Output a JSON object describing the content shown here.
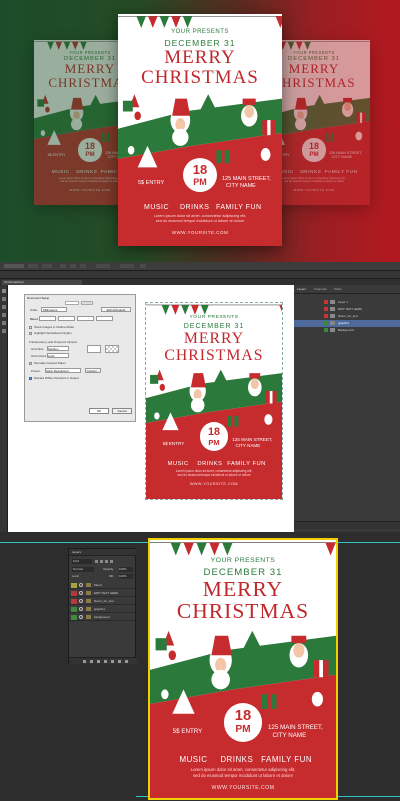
{
  "flyer": {
    "presents": "YOUR PRESENTS",
    "date": "DECEMBER 31",
    "title_line1": "MERRY",
    "title_line2": "CHRISTMAS",
    "price_number": "18",
    "price_unit": "PM",
    "entry": "5$ ENTRY",
    "address_line1": "125 MAIN STREET,",
    "address_line2": "CITY NAME",
    "features": [
      "MUSIC",
      "DRINKS",
      "FAMILY FUN"
    ],
    "lorem_line1": "Lorem ipsum dolor sit amet, consectetur adipiscing elit,",
    "lorem_line2": "sed do eiusmod tempor incididunt ut labore et dolore",
    "website": "WWW.YOURSITE.COM"
  },
  "photoshop": {
    "tab_label": "ChristmasFlyer",
    "dialog": {
      "title": "Document Setup",
      "tabs": [
        "General",
        "Bleed",
        "Size"
      ],
      "units_label": "Units:",
      "units_value": "Millimeters",
      "edit_artboards_button": "Edit Artboards",
      "bleed_label": "Bleed:",
      "bleed_fields": [
        "Top",
        "Bottom",
        "Left",
        "Right"
      ],
      "bleed_values": [
        "0.3 mm",
        "0.3 mm",
        "0.3 mm",
        "0.3 mm"
      ],
      "checkboxes": [
        "Show Images in Outline Mode",
        "Highlight Substituted Glyphs"
      ],
      "transparency_label": "Transparency and Overprint Options",
      "grid_size_label": "Grid Size:",
      "grid_size_value": "Medium",
      "grid_colors_label": "Grid Colors:",
      "grid_colors_value": "Light",
      "sim_paper": "Simulate Colored Paper",
      "preset_label": "Preset:",
      "preset_value": "[High Resolution]",
      "custom_button": "Custom...",
      "discard_white": "Discard White Overprint in Output",
      "ok_button": "OK",
      "cancel_button": "Cancel"
    },
    "panel_tabs": [
      "Layers",
      "Channels",
      "Paths"
    ],
    "layers_right": [
      "Layer 1",
      "EDIT TEXT HERE",
      "flower_for_text",
      "graphics",
      "Background"
    ]
  },
  "layers_panel": {
    "title": "Layers",
    "kind_label": "Kind",
    "blend_mode": "Normal",
    "opacity_label": "Opacity:",
    "opacity_value": "100%",
    "lock_label": "Lock:",
    "fill_label": "Fill:",
    "fill_value": "100%",
    "layers": [
      "Mood",
      "EDIT TEXT HERE",
      "flower_for_text",
      "graphics",
      "background"
    ],
    "layer_colors": [
      "#a8a23a",
      "#b23a3a",
      "#b23a3a",
      "#3f8a3f",
      "#3f8a3f"
    ]
  },
  "colors": {
    "red": "#c62b2e",
    "green": "#2b7a3b",
    "selection_yellow": "#f0d000"
  }
}
